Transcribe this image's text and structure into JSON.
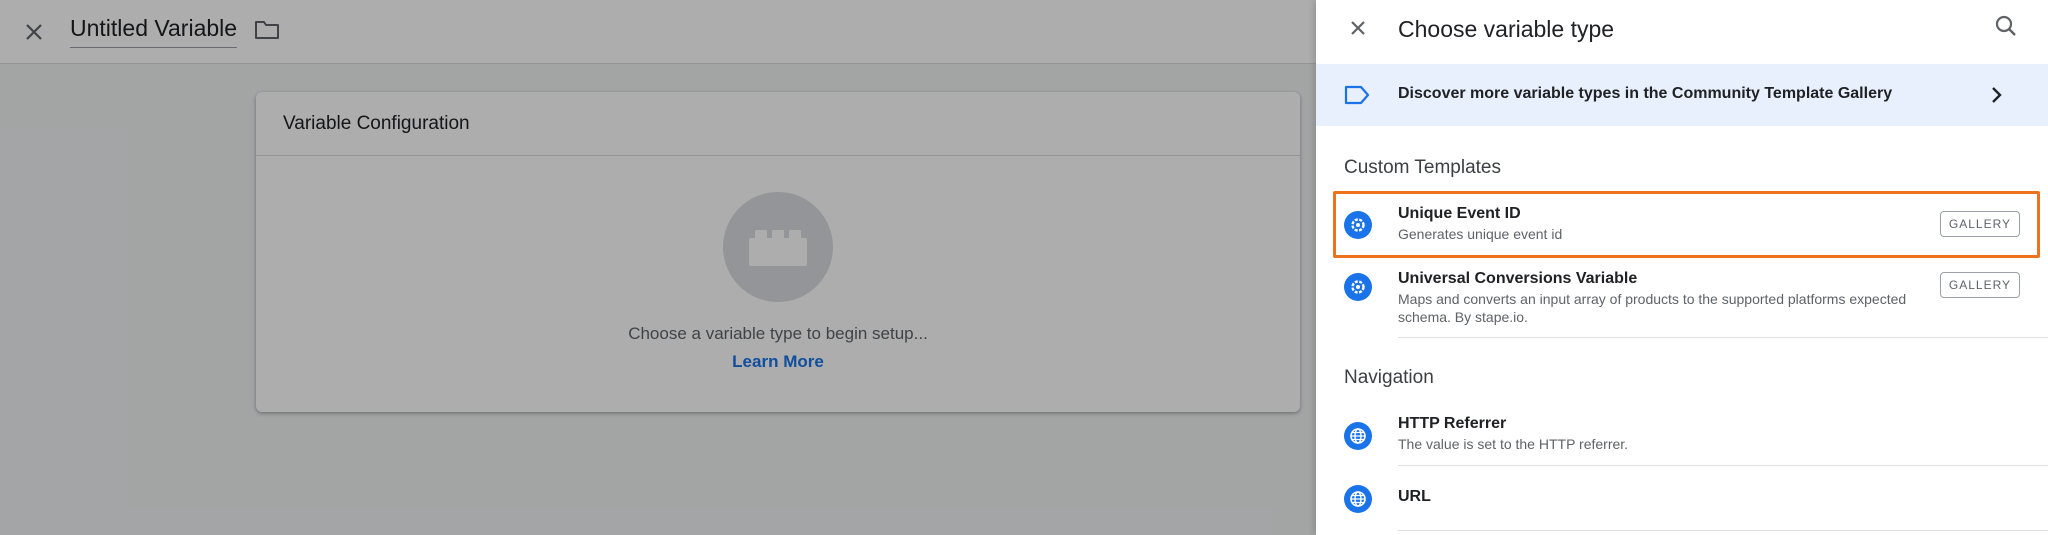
{
  "editor": {
    "title": "Untitled Variable",
    "config_card": {
      "heading": "Variable Configuration",
      "hint": "Choose a variable type to begin setup...",
      "learn_more": "Learn More"
    }
  },
  "panel": {
    "title": "Choose variable type",
    "banner": {
      "text": "Discover more variable types in the Community Template Gallery"
    },
    "sections": [
      {
        "title": "Custom Templates",
        "items": [
          {
            "name": "Unique Event ID",
            "description": "Generates unique event id",
            "badge": "GALLERY",
            "icon": "gear-icon",
            "highlighted": true
          },
          {
            "name": "Universal Conversions Variable",
            "description_line1": "Maps and converts an input array of products to the supported platforms expected",
            "description_line2": "schema. By stape.io.",
            "badge": "GALLERY",
            "icon": "gear-icon"
          }
        ]
      },
      {
        "title": "Navigation",
        "items": [
          {
            "name": "HTTP Referrer",
            "description": "The value is set to the HTTP referrer.",
            "icon": "globe-icon"
          },
          {
            "name": "URL",
            "icon": "globe-icon"
          }
        ]
      }
    ]
  },
  "colors": {
    "accent_blue": "#1a73e8",
    "banner_bg": "#e8f0fe",
    "highlight_orange": "#f0711d"
  }
}
